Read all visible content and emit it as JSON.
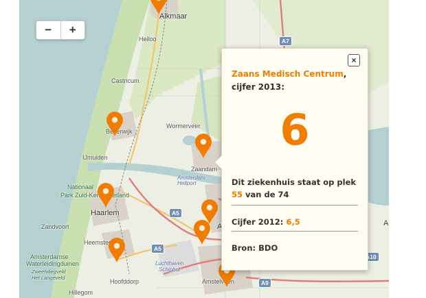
{
  "map": {
    "places": {
      "alkmaar": "Alkmaar",
      "heiloo": "Heiloo",
      "castricum": "Castricum",
      "beverwijk": "Beverwijk",
      "wormerveer": "Wormerveer",
      "ijmuiden": "IJmuiden",
      "zaandam": "Zaandam",
      "amsterdam_heliport": "Amsterdam Heliport",
      "np_line1": "Nationaal",
      "np_line2": "Park Zuid-Kennemerland",
      "haarlem": "Haarlem",
      "zandvoort": "Zandvoort",
      "heemstede": "Heemstede",
      "awd_line1": "Amsterdamse",
      "awd_line2": "Waterleidingduinen",
      "zweefvliegveld_line1": "Zweefvliegveld",
      "zweefvliegveld_line2": "Het Langeveld",
      "luchthaven_line1": "Luchthaven",
      "luchthaven_line2": "Schiphol",
      "hoofddorp": "Hoofddorp",
      "amstelveen": "Amstelveen",
      "hillegom": "Hillegom",
      "a_fragment": "A",
      "a_east": "A"
    },
    "roads": {
      "a7": "A7",
      "a5_1": "A5",
      "a5_2": "A5",
      "a9": "A9",
      "a10": "A10"
    }
  },
  "zoom": {
    "minus": "−",
    "plus": "+"
  },
  "popup": {
    "close": "×",
    "hospital": "Zaans Medisch Centrum",
    "comma": ",",
    "score_label": "cijfer 2013:",
    "score": "6",
    "rank_text": "Dit ziekenhuis staat op plek",
    "rank": "55",
    "rank_suffix": "van de 74",
    "prev_label": "Cijfer 2012:",
    "prev_value": "6,5",
    "source": "Bron: BDO"
  },
  "colors": {
    "accent": "#f07d00",
    "motorway": "#6f8fb3",
    "water": "#b5d0d0",
    "park": "#c9dfb0"
  }
}
